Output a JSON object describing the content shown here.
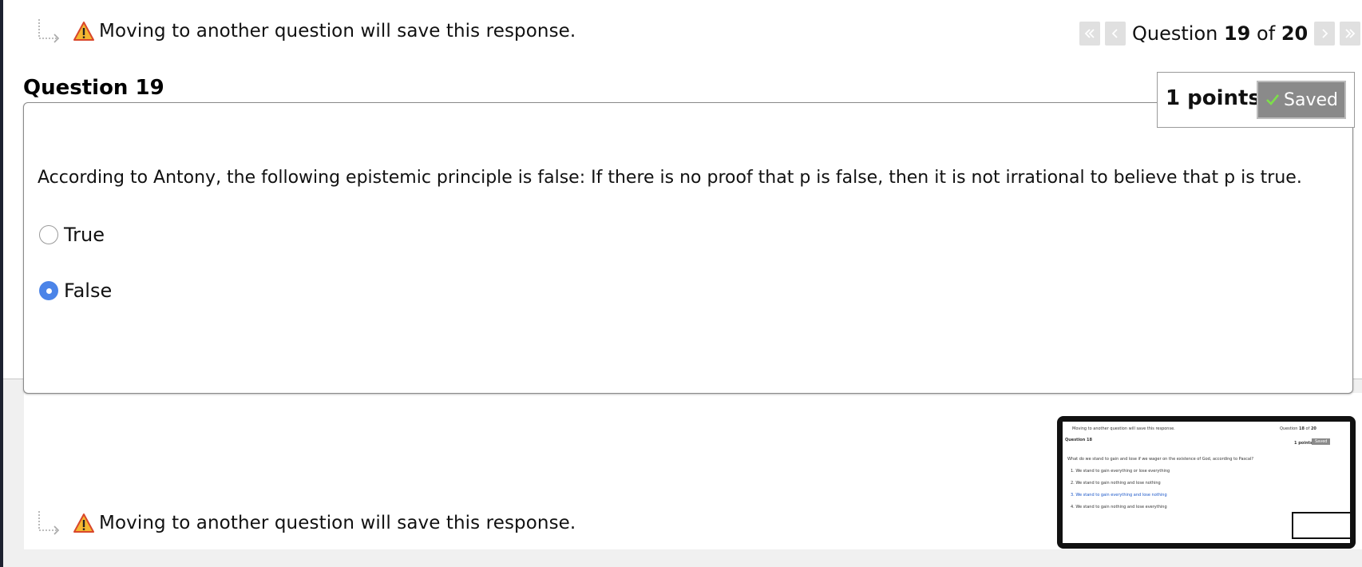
{
  "notice": {
    "text": "Moving to another question will save this response."
  },
  "nav": {
    "prefix": "Question",
    "current": "19",
    "of": "of",
    "total": "20"
  },
  "question": {
    "title": "Question 19",
    "points": "1 points",
    "saved_label": "Saved",
    "text": "According to Antony, the following epistemic principle is false:  If there is no proof that p is false, then it is not irrational to believe that p is true.",
    "options": [
      {
        "label": "True",
        "selected": false
      },
      {
        "label": "False",
        "selected": true
      }
    ]
  },
  "thumbnail": {
    "notice": "Moving to another question will save this response.",
    "nav_prefix": "Question",
    "nav_current": "18",
    "nav_of": "of",
    "nav_total": "20",
    "title": "Question 18",
    "points": "1 points",
    "saved_label": "Saved",
    "question_text": "What do we stand to gain and lose if we wager on the existence of God, according to Pascal?",
    "options": [
      "1. We stand to gain everything or lose everything",
      "2. We stand to gain nothing and lose nothing",
      "3. We stand to gain everything and lose nothing",
      "4. We stand to gain nothing and lose everything"
    ]
  },
  "colors": {
    "accent": "#4b84e8",
    "saved_bg": "#8a8a8a",
    "warning": "#f0a020"
  }
}
